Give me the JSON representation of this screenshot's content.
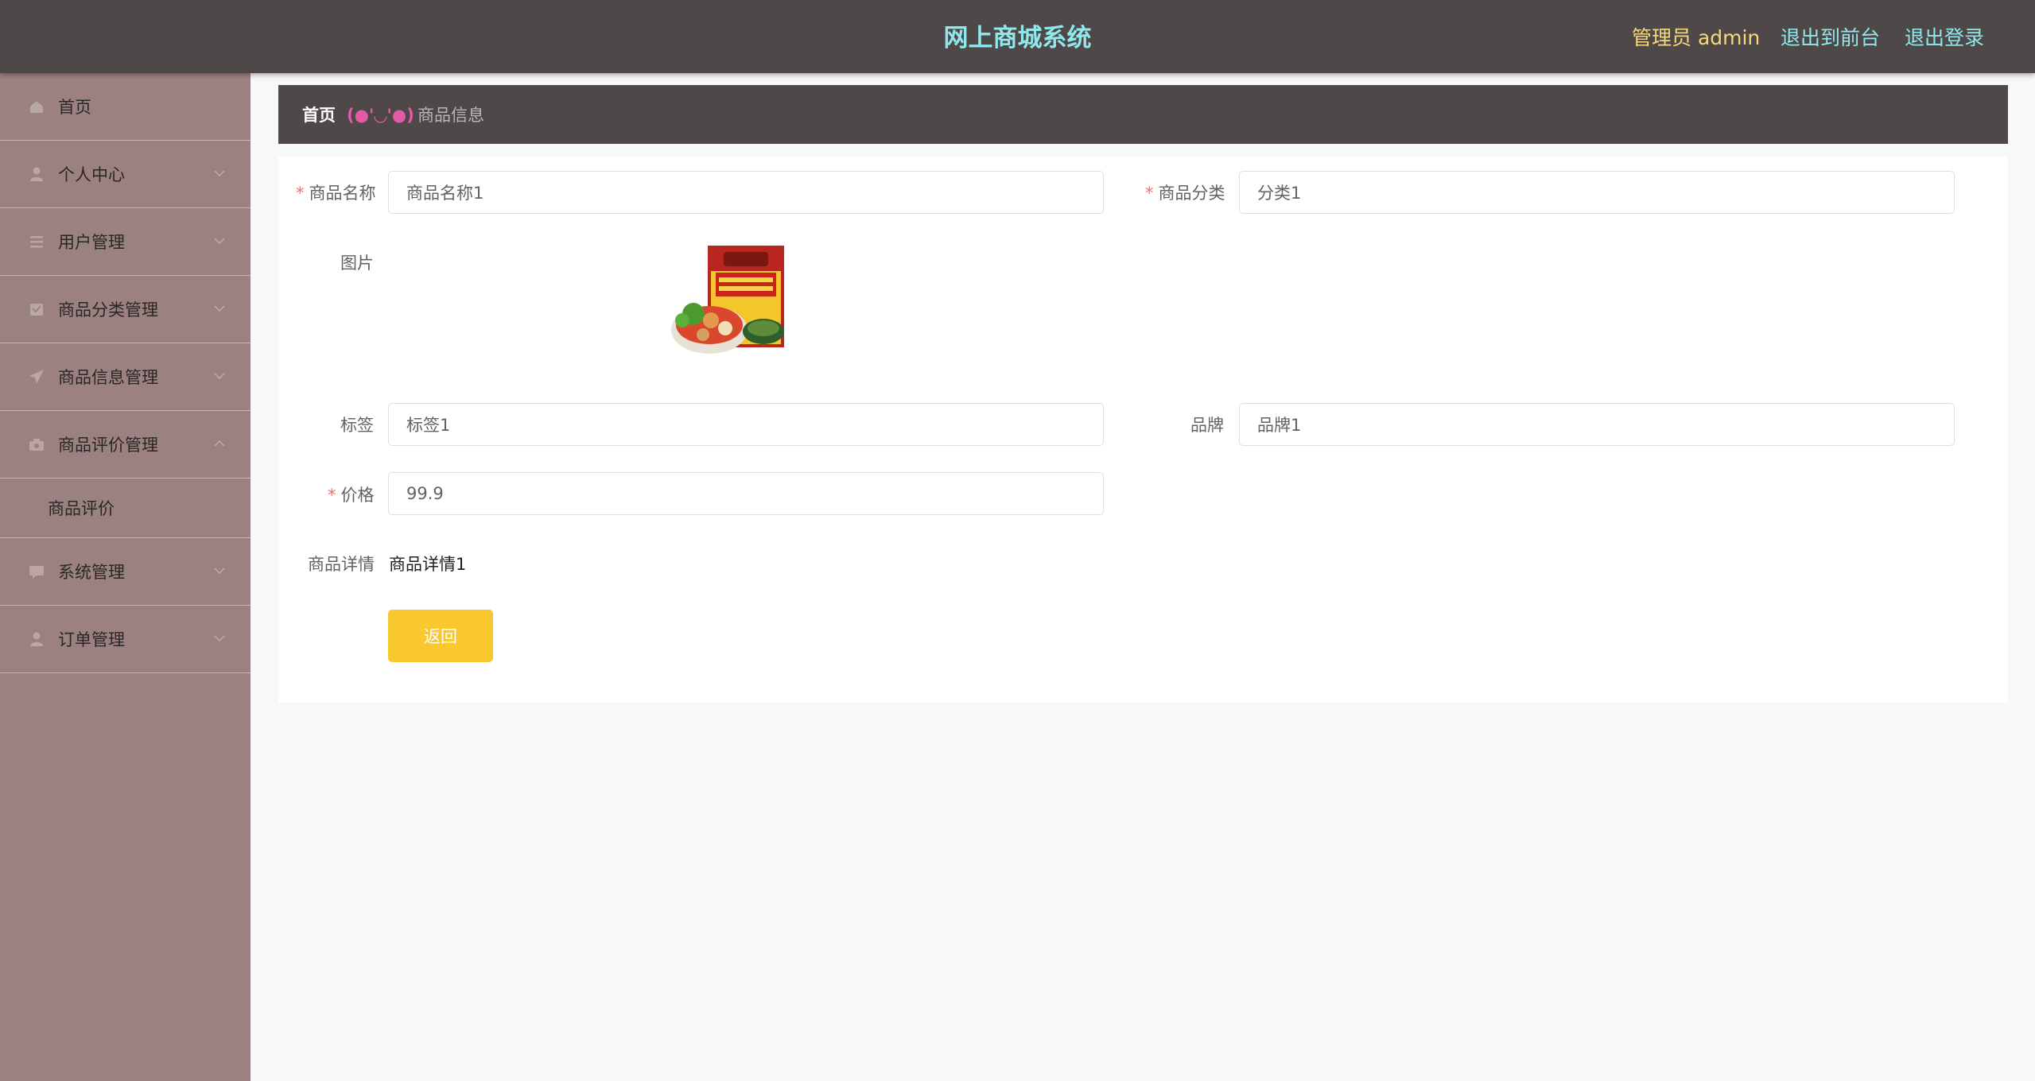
{
  "header": {
    "title": "网上商城系统",
    "user_info": "管理员 admin",
    "to_front_label": "退出到前台",
    "logout_label": "退出登录"
  },
  "sidebar": {
    "items": [
      {
        "label": "首页",
        "icon": "home-icon"
      },
      {
        "label": "个人中心",
        "icon": "user-icon"
      },
      {
        "label": "用户管理",
        "icon": "list-icon"
      },
      {
        "label": "商品分类管理",
        "icon": "folder-icon"
      },
      {
        "label": "商品信息管理",
        "icon": "send-icon"
      },
      {
        "label": "商品评价管理",
        "icon": "camera-icon"
      },
      {
        "label": "商品评价",
        "icon": ""
      },
      {
        "label": "系统管理",
        "icon": "message-icon"
      },
      {
        "label": "订单管理",
        "icon": "user-icon"
      }
    ]
  },
  "breadcrumb": {
    "home": "首页",
    "separator": "(●'◡'●)",
    "current": "商品信息"
  },
  "form": {
    "name_label": "商品名称",
    "name_value": "商品名称1",
    "category_label": "商品分类",
    "category_value": "分类1",
    "image_label": "图片",
    "tag_label": "标签",
    "tag_value": "标签1",
    "brand_label": "品牌",
    "brand_value": "品牌1",
    "price_label": "价格",
    "price_value": "99.9",
    "detail_label": "商品详情",
    "detail_value": "商品详情1",
    "return_label": "返回",
    "required_mark": "*"
  },
  "colors": {
    "header_bg": "#4f4848",
    "title": "#8fe8ec",
    "user": "#f7d777",
    "sidebar_bg": "#9b8281",
    "button": "#f9c82e",
    "required": "#f56c6c"
  }
}
